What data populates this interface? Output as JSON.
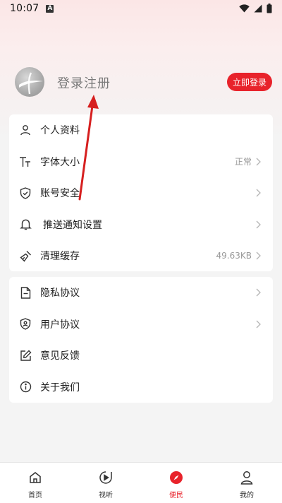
{
  "status_bar": {
    "time": "10:07",
    "notification_glyph": "A"
  },
  "profile": {
    "login_prompt": "登录注册",
    "login_button": "立即登录"
  },
  "settings_group_1": [
    {
      "label": "个人资料",
      "value": "",
      "icon": "user-icon",
      "chevron": false
    },
    {
      "label": "字体大小",
      "value": "正常",
      "icon": "font-size-icon",
      "chevron": true
    },
    {
      "label": "账号安全",
      "value": "",
      "icon": "shield-check-icon",
      "chevron": true
    },
    {
      "label": "推送通知设置",
      "value": "",
      "icon": "bell-icon",
      "chevron": true
    },
    {
      "label": "清理缓存",
      "value": "49.63KB",
      "icon": "broom-icon",
      "chevron": true
    }
  ],
  "settings_group_2": [
    {
      "label": "隐私协议",
      "value": "",
      "icon": "document-icon",
      "chevron": true
    },
    {
      "label": "用户协议",
      "value": "",
      "icon": "shield-user-icon",
      "chevron": true
    },
    {
      "label": "意见反馈",
      "value": "",
      "icon": "edit-icon",
      "chevron": false
    },
    {
      "label": "关于我们",
      "value": "",
      "icon": "info-icon",
      "chevron": false
    }
  ],
  "bottom_nav": [
    {
      "label": "首页",
      "icon": "home-icon",
      "active": false
    },
    {
      "label": "视听",
      "icon": "play-icon",
      "active": false
    },
    {
      "label": "便民",
      "icon": "compass-icon",
      "active": true
    },
    {
      "label": "我的",
      "icon": "profile-icon",
      "active": false
    }
  ],
  "colors": {
    "accent": "#e8232b",
    "annotation_arrow": "#d61f1f"
  }
}
